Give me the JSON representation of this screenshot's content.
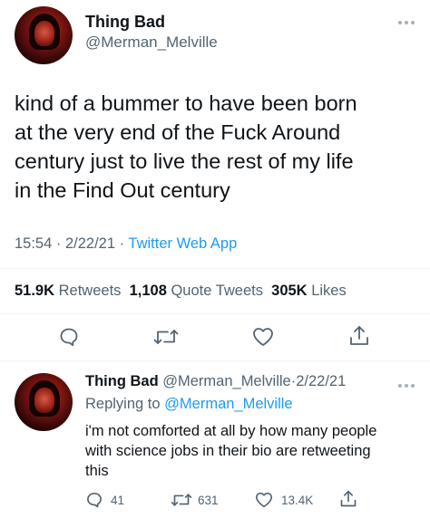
{
  "main_tweet": {
    "display_name": "Thing Bad",
    "handle": "@Merman_Melville",
    "text_lines": [
      "kind of a bummer to have been born",
      "at the very end of the Fuck Around",
      "century just to live the rest of my life",
      "in the Find Out century"
    ],
    "time": "15:54",
    "date": "2/22/21",
    "source": "Twitter Web App",
    "retweets_count": "51.9K",
    "retweets_label": "Retweets",
    "quotes_count": "1,108",
    "quotes_label": "Quote Tweets",
    "likes_count": "305K",
    "likes_label": "Likes"
  },
  "reply_tweet": {
    "display_name": "Thing Bad",
    "handle": "@Merman_Melville",
    "date": "2/22/21",
    "replying_prefix": "Replying to",
    "replying_handle": "@Merman_Melville",
    "text_lines": [
      "i'm not comforted at all by how many people",
      "with science jobs in their bio are retweeting",
      "this"
    ],
    "reply_count": "41",
    "retweet_count": "631",
    "like_count": "13.4K"
  },
  "icons": {
    "more": "more-icon",
    "reply": "reply-icon",
    "retweet": "retweet-icon",
    "like": "heart-icon",
    "share": "share-icon"
  },
  "colors": {
    "text": "#0f1419",
    "secondary": "#536471",
    "accent": "#1d9bf0",
    "divider": "#eff3f4"
  }
}
